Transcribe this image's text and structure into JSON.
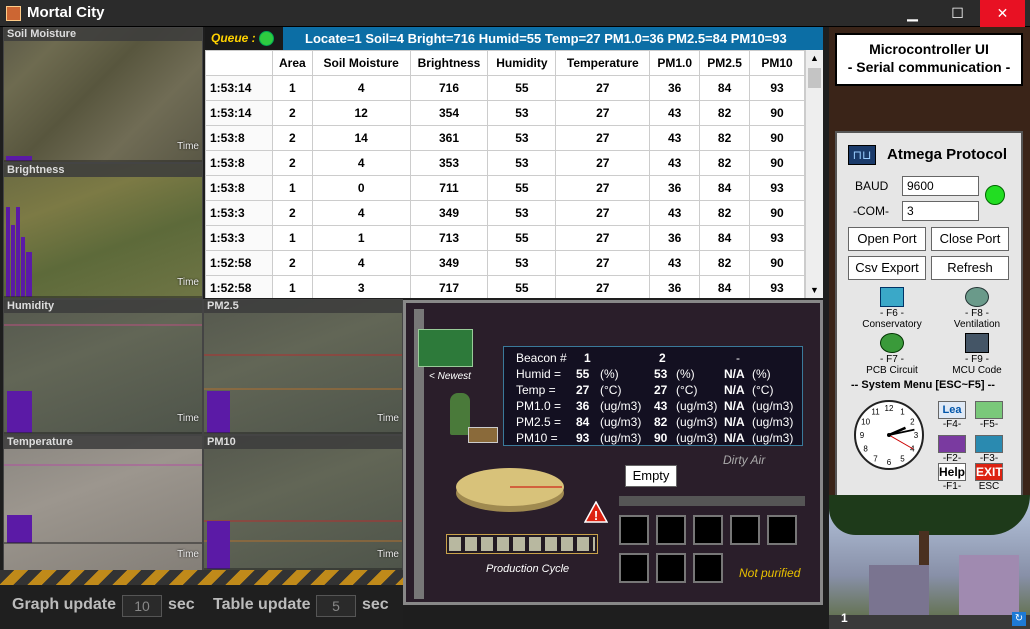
{
  "window": {
    "title": "Mortal City",
    "min": "▁",
    "max": "☐",
    "close": "✕"
  },
  "charts": {
    "soil": {
      "title": "Soil Moisture",
      "time": "Time"
    },
    "brightness": {
      "title": "Brightness",
      "time": "Time"
    },
    "humidity": {
      "title": "Humidity",
      "time": "Time"
    },
    "pm25": {
      "title": "PM2.5",
      "time": "Time"
    },
    "temperature": {
      "title": "Temperature",
      "time": "Time"
    },
    "pm10": {
      "title": "PM10",
      "time": "Time"
    }
  },
  "queue": {
    "label": "Queue :",
    "status": "Locate=1 Soil=4 Bright=716 Humid=55 Temp=27 PM1.0=36 PM2.5=84 PM10=93"
  },
  "table": {
    "headers": [
      "",
      "Area",
      "Soil Moisture",
      "Brightness",
      "Humidity",
      "Temperature",
      "PM1.0",
      "PM2.5",
      "PM10"
    ],
    "rows": [
      [
        "1:53:14",
        "1",
        "4",
        "716",
        "55",
        "27",
        "36",
        "84",
        "93"
      ],
      [
        "1:53:14",
        "2",
        "12",
        "354",
        "53",
        "27",
        "43",
        "82",
        "90"
      ],
      [
        "1:53:8",
        "2",
        "14",
        "361",
        "53",
        "27",
        "43",
        "82",
        "90"
      ],
      [
        "1:53:8",
        "2",
        "4",
        "353",
        "53",
        "27",
        "43",
        "82",
        "90"
      ],
      [
        "1:53:8",
        "1",
        "0",
        "711",
        "55",
        "27",
        "36",
        "84",
        "93"
      ],
      [
        "1:53:3",
        "2",
        "4",
        "349",
        "53",
        "27",
        "43",
        "82",
        "90"
      ],
      [
        "1:53:3",
        "1",
        "1",
        "713",
        "55",
        "27",
        "36",
        "84",
        "93"
      ],
      [
        "1:52:58",
        "2",
        "4",
        "349",
        "53",
        "27",
        "43",
        "82",
        "90"
      ],
      [
        "1:52:58",
        "1",
        "3",
        "717",
        "55",
        "27",
        "36",
        "84",
        "93"
      ]
    ]
  },
  "circuit": {
    "newest": "< Newest",
    "readout": {
      "l_beacon": "Beacon #",
      "b1": "1",
      "b2": "2",
      "b3": "-",
      "l_humid": "Humid =",
      "h1": "55",
      "h2": "53",
      "h3": "N/A",
      "u_humid": "(%)",
      "l_temp": "Temp =",
      "t1": "27",
      "t2": "27",
      "t3": "N/A",
      "u_temp": "(°C)",
      "l_pm1": "PM1.0 =",
      "p11": "36",
      "p12": "43",
      "p13": "N/A",
      "l_pm25": "PM2.5 =",
      "p21": "84",
      "p22": "82",
      "p23": "N/A",
      "l_pm10": "PM10 =",
      "p31": "93",
      "p32": "90",
      "p33": "N/A",
      "u_pm": "(ug/m3)"
    },
    "dirty_air": "Dirty Air",
    "empty_button": "Empty",
    "production_cycle": "Production Cycle",
    "not_purified": "Not purified"
  },
  "bottom": {
    "graph_label": "Graph update",
    "graph_value": "10",
    "graph_unit": "sec",
    "table_label": "Table update",
    "table_value": "5",
    "table_unit": "sec"
  },
  "right": {
    "title1": "Microcontroller UI",
    "title2": "- Serial communication -",
    "protocol": "Atmega Protocol",
    "baud_label": "BAUD",
    "baud_value": "9600",
    "com_label": "-COM-",
    "com_value": "3",
    "open_port": "Open Port",
    "close_port": "Close Port",
    "csv_export": "Csv Export",
    "refresh": "Refresh",
    "f6": "- F6 -",
    "conservatory": "Conservatory",
    "f8": "- F8 -",
    "ventilation": "Ventilation",
    "f7": "- F7 -",
    "pcb": "PCB Circuit",
    "f9": "- F9 -",
    "mcu": "MCU Code",
    "system_menu": "-- System Menu [ESC~F5] --",
    "fk4": "-F4-",
    "fk5": "-F5-",
    "fk2": "-F2-",
    "fk3": "-F3-",
    "fk1": "-F1-",
    "esc": "ESC",
    "help": "Help",
    "exit": "EXIT",
    "clock": {
      "hours": 2,
      "minutes": 13,
      "seconds": 20
    },
    "clock_nums": [
      "12",
      "1",
      "2",
      "3",
      "4",
      "5",
      "6",
      "7",
      "8",
      "9",
      "10",
      "11"
    ],
    "scene_number": "1"
  },
  "colors": {
    "bar": "#5b1aa6",
    "queue_led": "#2ecc40",
    "led_right": "#22dd22"
  }
}
